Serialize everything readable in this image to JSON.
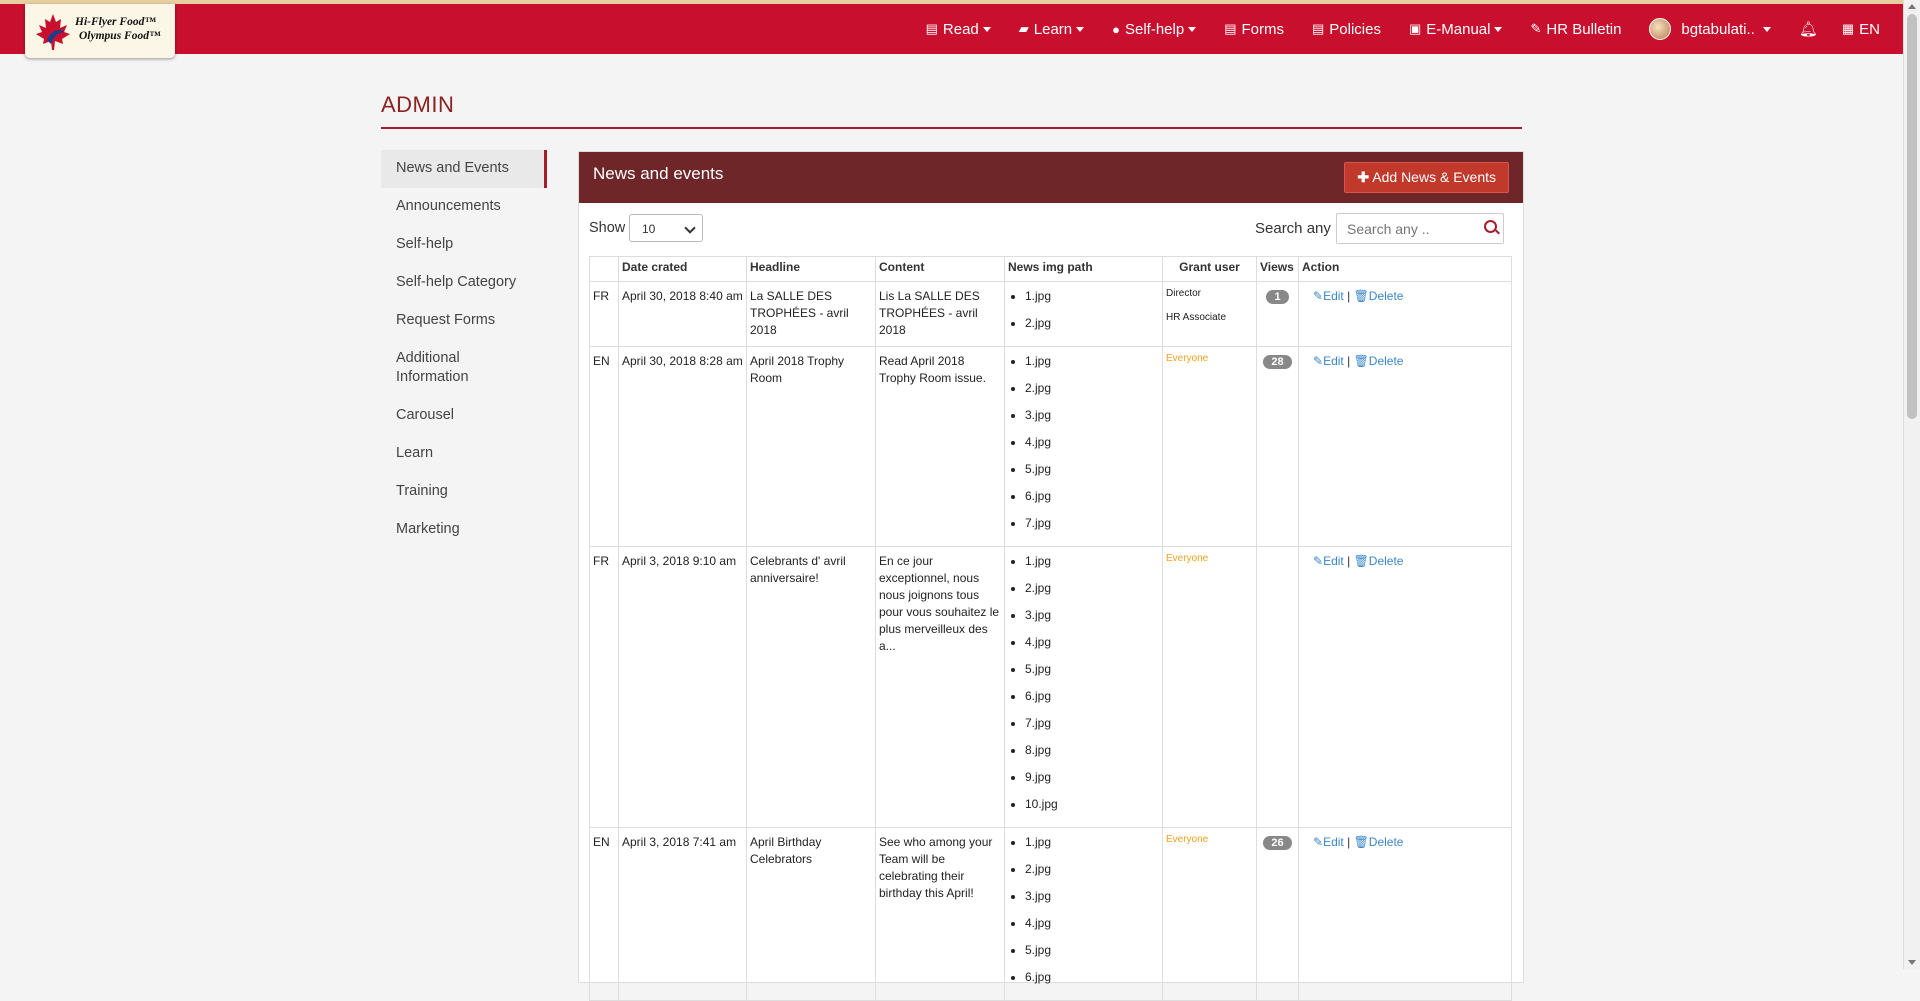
{
  "app": {
    "logo_line1": "Hi-Flyer Food™",
    "logo_line2": "Olympus Food™"
  },
  "nav": [
    {
      "label": "Read",
      "icon": "newspaper-icon",
      "dropdown": true
    },
    {
      "label": "Learn",
      "icon": "book-icon",
      "dropdown": true
    },
    {
      "label": "Self-help",
      "icon": "info-circle-icon",
      "dropdown": true
    },
    {
      "label": "Forms",
      "icon": "form-icon",
      "dropdown": false
    },
    {
      "label": "Policies",
      "icon": "policy-icon",
      "dropdown": false
    },
    {
      "label": "E-Manual",
      "icon": "manual-icon",
      "dropdown": true
    },
    {
      "label": "HR Bulletin",
      "icon": "pin-icon",
      "dropdown": false
    }
  ],
  "user": {
    "name": "bgtabulati..",
    "language": "EN"
  },
  "page": {
    "title": "ADMIN"
  },
  "sidebar": {
    "items": [
      "News and Events",
      "Announcements",
      "Self-help",
      "Self-help Category",
      "Request Forms",
      "Additional Information",
      "Carousel",
      "Learn",
      "Training",
      "Marketing"
    ]
  },
  "panel": {
    "title": "News and events",
    "add_button": "Add News & Events",
    "show_label": "Show",
    "show_value": "10",
    "search_label": "Search any",
    "search_placeholder": "Search any ..",
    "columns": [
      "",
      "Date crated",
      "Headline",
      "Content",
      "News img path",
      "Grant user",
      "Views",
      "Action"
    ],
    "rows": [
      {
        "lang": "FR",
        "date": "April 30, 2018 8:40 am",
        "headline": "La SALLE DES TROPHÉES - avril 2018",
        "content": "Lis La SALLE DES TROPHÉES - avril 2018",
        "images": [
          "1.jpg",
          "2.jpg"
        ],
        "grant": [
          "Director",
          "HR Associate"
        ],
        "views": "1"
      },
      {
        "lang": "EN",
        "date": "April 30, 2018 8:28 am",
        "headline": "April 2018 Trophy Room",
        "content": "Read April 2018 Trophy Room issue.",
        "images": [
          "1.jpg",
          "2.jpg",
          "3.jpg",
          "4.jpg",
          "5.jpg",
          "6.jpg",
          "7.jpg"
        ],
        "grant": [
          "Everyone"
        ],
        "views": "28"
      },
      {
        "lang": "FR",
        "date": "April 3, 2018 9:10 am",
        "headline": "Celebrants d' avril anniversaire!",
        "content": "En ce jour exceptionnel, nous nous joignons tous pour vous  souhaitez le plus merveilleux des a...",
        "images": [
          "1.jpg",
          "2.jpg",
          "3.jpg",
          "4.jpg",
          "5.jpg",
          "6.jpg",
          "7.jpg",
          "8.jpg",
          "9.jpg",
          "10.jpg"
        ],
        "grant": [
          "Everyone"
        ],
        "views": ""
      },
      {
        "lang": "EN",
        "date": "April 3, 2018 7:41 am",
        "headline": "April Birthday Celebrators",
        "content": "See who among your Team will be celebrating their birthday this April!",
        "images": [
          "1.jpg",
          "2.jpg",
          "3.jpg",
          "4.jpg",
          "5.jpg",
          "6.jpg"
        ],
        "grant": [
          "Everyone"
        ],
        "views": "26"
      }
    ],
    "edit_label": "Edit",
    "delete_label": "Delete"
  },
  "colors": {
    "navbar": "#c8102e",
    "panel_header": "#6e2628",
    "accent": "#a51d2d",
    "link": "#3a86c8",
    "everyone": "#f0a020"
  }
}
